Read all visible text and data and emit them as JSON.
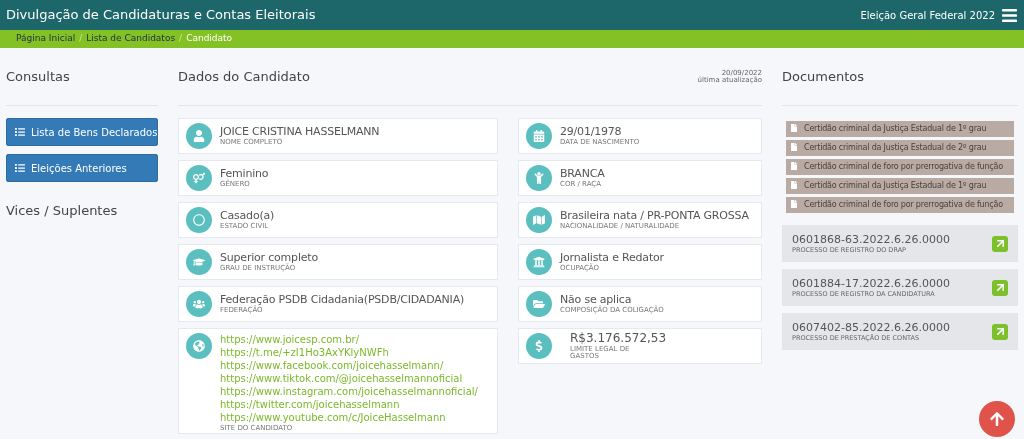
{
  "header": {
    "title": "Divulgação de Candidaturas e Contas Eleitorais",
    "election": "Eleição Geral Federal 2022"
  },
  "breadcrumb_separator": "/",
  "breadcrumb": [
    {
      "label": "Página Inicial",
      "selected": false
    },
    {
      "label": "Lista de Candidatos",
      "selected": false
    },
    {
      "label": "Candidato",
      "selected": true
    }
  ],
  "sidebar": {
    "title": "Consultas",
    "buttons": [
      "Lista de Bens Declarados",
      "Eleições Anteriores"
    ],
    "section": "Vices / Suplentes"
  },
  "candidate": {
    "title": "Dados do Candidato",
    "updated_date": "20/09/2022",
    "updated_label": "última atualização",
    "left_cards": [
      {
        "value": "JOICE CRISTINA HASSELMANN",
        "label": "NOME COMPLETO"
      },
      {
        "value": "Feminino",
        "label": "GÊNERO"
      },
      {
        "value": "Casado(a)",
        "label": "ESTADO CIVIL"
      },
      {
        "value": "Superior completo",
        "label": "GRAU DE INSTRUÇÃO"
      },
      {
        "value": "Federação PSDB Cidadania(PSDB/CIDADANIA)",
        "label": "FEDERAÇÃO"
      }
    ],
    "right_cards": [
      {
        "value": "29/01/1978",
        "label": "DATA DE NASCIMENTO"
      },
      {
        "value": "BRANCA",
        "label": "COR / RAÇA"
      },
      {
        "value": "Brasileira nata / PR-PONTA GROSSA",
        "label": "NACIONALIDADE / NATURALIDADE"
      },
      {
        "value": "Jornalista e Redator",
        "label": "OCUPAÇÃO"
      },
      {
        "value": "Não se aplica",
        "label": "COMPOSIÇÃO DA COLIGAÇÃO"
      }
    ],
    "website": {
      "links": [
        "https://www.joicesp.com.br/",
        "https://t.me/+zI1Ho3AxYKlyNWFh",
        "https://www.facebook.com/joicehasselmann/",
        "https://www.tiktok.com/@joicehasselmannoficial",
        "https://www.instagram.com/joicehasselmannoficial/",
        "https://twitter.com/joicehasselmann",
        "https://www.youtube.com/c/JoiceHasselmann"
      ],
      "label": "SITE DO CANDIDATO"
    },
    "spending": {
      "value": "R$3.176.572,53",
      "label": "LIMITE LEGAL DE GASTOS"
    }
  },
  "documents": {
    "title": "Documentos",
    "files": [
      "Certidão criminal da Justiça Estadual de 1º grau",
      "Certidão criminal da Justiça Estadual de 2º grau",
      "Certidão criminal de foro por prerrogativa de função",
      "Certidão criminal da Justiça Estadual de 1º grau",
      "Certidão criminal de foro por prerrogativa de função"
    ],
    "processes": [
      {
        "number": "0601868-63.2022.6.26.0000",
        "label": "PROCESSO DE REGISTRO DO DRAP"
      },
      {
        "number": "0601884-17.2022.6.26.0000",
        "label": "PROCESSO DE REGISTRO DA CANDIDATURA"
      },
      {
        "number": "0607402-85.2022.6.26.0000",
        "label": "PROCESSO DE PRESTAÇÃO DE CONTAS"
      }
    ]
  }
}
